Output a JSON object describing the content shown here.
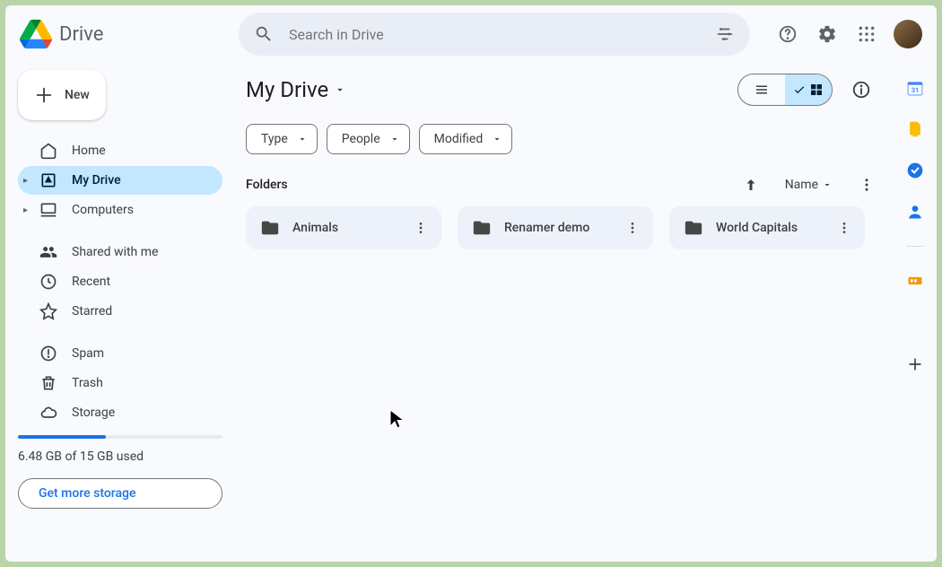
{
  "brand": {
    "name": "Drive"
  },
  "search": {
    "placeholder": "Search in Drive"
  },
  "new_button": {
    "label": "New"
  },
  "sidebar": {
    "items": [
      {
        "label": "Home"
      },
      {
        "label": "My Drive"
      },
      {
        "label": "Computers"
      },
      {
        "label": "Shared with me"
      },
      {
        "label": "Recent"
      },
      {
        "label": "Starred"
      },
      {
        "label": "Spam"
      },
      {
        "label": "Trash"
      },
      {
        "label": "Storage"
      }
    ],
    "storage": {
      "text": "6.48 GB of 15 GB used",
      "percent": 43,
      "cta": "Get more storage"
    }
  },
  "main": {
    "title": "My Drive",
    "filters": [
      {
        "label": "Type"
      },
      {
        "label": "People"
      },
      {
        "label": "Modified"
      }
    ],
    "section_label": "Folders",
    "sort_label": "Name",
    "folders": [
      {
        "name": "Animals"
      },
      {
        "name": "Renamer demo"
      },
      {
        "name": "World Capitals"
      }
    ]
  },
  "rail_calendar_day": "31"
}
